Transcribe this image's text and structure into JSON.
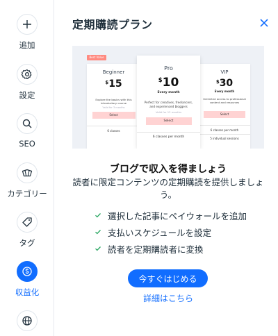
{
  "sidebar": {
    "items": [
      {
        "label": "追加",
        "icon": "plus-icon"
      },
      {
        "label": "設定",
        "icon": "gear-icon"
      },
      {
        "label": "SEO",
        "icon": "search-icon"
      },
      {
        "label": "カテゴリー",
        "icon": "category-icon"
      },
      {
        "label": "タグ",
        "icon": "tag-icon"
      },
      {
        "label": "収益化",
        "icon": "dollar-icon",
        "active": true
      },
      {
        "label": "",
        "icon": "globe-icon"
      }
    ],
    "accent_color": "#116dff"
  },
  "panel": {
    "title": "定期購読プラン",
    "close_icon": "close-icon",
    "heading": "ブログで収入を得ましょう",
    "subtext": "読者に限定コンテンツの定期購読を提供しましょう。",
    "features": [
      "選択した記事にペイウォールを追加",
      "支払いスケジュールを設定",
      "読者を定期購読者に変換"
    ],
    "cta_label": "今すぐはじめる",
    "more_link": "詳細はこちら"
  },
  "illustration": {
    "badge": "Best Value",
    "plans": [
      {
        "name": "Beginner",
        "currency": "$",
        "price": "15",
        "period": "",
        "description": "Explore the basics with this introductory course",
        "validity": "Valid for 3 months",
        "select": "Select",
        "feature": "6 classes"
      },
      {
        "name": "Pro",
        "currency": "$",
        "price": "10",
        "period": "Every month",
        "description": "Perfect for creatives, freelancers, and experienced bloggers",
        "validity": "Valid for 12 months",
        "select": "Select",
        "feature": "6 classes per month"
      },
      {
        "name": "VIP",
        "currency": "$",
        "price": "30",
        "period": "Every month",
        "description": "Unlimited access to professional content and resources",
        "validity": "",
        "select": "Select",
        "feature": "6 classes per month",
        "feature2": "5 individual sessions"
      }
    ]
  }
}
